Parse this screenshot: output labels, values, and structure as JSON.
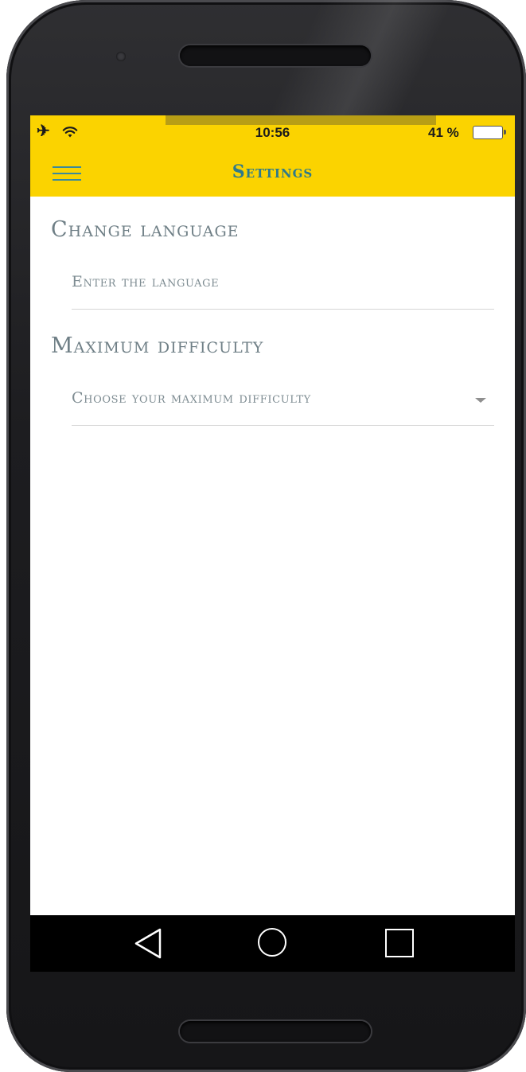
{
  "status_bar": {
    "time": "10:56",
    "battery_percent": "41 %",
    "airplane_icon": "airplane-icon",
    "wifi_icon": "wifi-icon",
    "battery_level": 0.41
  },
  "app_bar": {
    "title": "Settings",
    "menu_icon": "hamburger-menu-icon"
  },
  "settings": {
    "language": {
      "heading": "Change language",
      "placeholder": "Enter the language",
      "value": ""
    },
    "difficulty": {
      "heading": "Maximum difficulty",
      "placeholder": "Choose your maximum difficulty",
      "dropdown_icon": "chevron-down-icon"
    }
  },
  "nav_bar": {
    "back_icon": "back-triangle-icon",
    "home_icon": "home-circle-icon",
    "recents_icon": "recents-square-icon"
  },
  "colors": {
    "app_bar_background": "#fbd300",
    "title_color": "#2f7a8a",
    "heading_color": "#6f7f86",
    "nav_bar_background": "#000000"
  }
}
